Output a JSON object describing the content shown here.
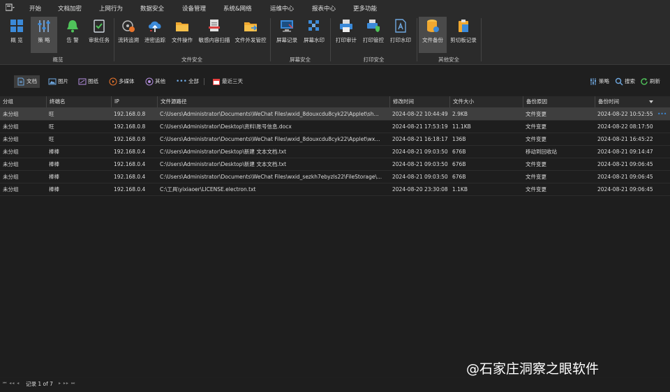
{
  "menubar": {
    "items": [
      "开始",
      "文档加密",
      "上网行为",
      "数据安全",
      "设备管理",
      "系统&网络",
      "运维中心",
      "报表中心",
      "更多功能"
    ],
    "active": "数据安全"
  },
  "ribbon": {
    "groups": [
      {
        "label": "概览",
        "buttons": [
          {
            "label": "概 览",
            "icon": "grid-icon"
          },
          {
            "label": "策 略",
            "icon": "sliders-icon",
            "active": true
          },
          {
            "label": "告 警",
            "icon": "bell-icon"
          },
          {
            "label": "审批任务",
            "icon": "checklist-icon"
          }
        ]
      },
      {
        "label": "文件安全",
        "buttons": [
          {
            "label": "流转追溯",
            "icon": "trace-icon"
          },
          {
            "label": "泄密追踪",
            "icon": "cloud-upload-icon"
          },
          {
            "label": "文件操作",
            "icon": "folder-icon"
          },
          {
            "label": "敏感内容扫描",
            "icon": "document-scan-icon"
          },
          {
            "label": "文件外发管控",
            "icon": "folder-send-icon"
          }
        ]
      },
      {
        "label": "屏幕安全",
        "buttons": [
          {
            "label": "屏幕记录",
            "icon": "monitor-icon"
          },
          {
            "label": "屏幕水印",
            "icon": "mosaic-icon"
          }
        ]
      },
      {
        "label": "打印安全",
        "buttons": [
          {
            "label": "打印审计",
            "icon": "printer-icon"
          },
          {
            "label": "打印管控",
            "icon": "printer-shield-icon"
          },
          {
            "label": "打印水印",
            "icon": "document-a-icon"
          }
        ]
      },
      {
        "label": "其他安全",
        "buttons": [
          {
            "label": "文件备份",
            "icon": "database-backup-icon",
            "active": true
          },
          {
            "label": "剪切板记录",
            "icon": "clipboard-icon"
          }
        ]
      }
    ]
  },
  "toolbar": {
    "filters": [
      {
        "label": "文档",
        "icon": "document-icon",
        "active": true
      },
      {
        "label": "图片",
        "icon": "image-icon"
      },
      {
        "label": "图纸",
        "icon": "drawing-icon"
      },
      {
        "label": "多媒体",
        "icon": "media-icon"
      },
      {
        "label": "其他",
        "icon": "other-icon"
      },
      {
        "label": "全部",
        "icon": "dots-icon"
      }
    ],
    "date_range": "最近三天",
    "strategy": "策略",
    "search": "搜索",
    "refresh": "刷新"
  },
  "table": {
    "columns": [
      "分组",
      "终端名",
      "IP",
      "文件源路径",
      "修改时间",
      "文件大小",
      "备份原因",
      "备份时间"
    ],
    "rows": [
      [
        "未分组",
        "旺",
        "192.168.0.8",
        "C:\\Users\\Administrator\\Documents\\WeChat Files\\wxid_8douxcdu8cyk22\\Applet\\sh...",
        "2024-08-22 10:44:49",
        "2.9KB",
        "文件变更",
        "2024-08-22 10:52:55"
      ],
      [
        "未分组",
        "旺",
        "192.168.0.8",
        "C:\\Users\\Administrator\\Desktop\\资料\\账号信息.docx",
        "2024-08-21 17:53:19",
        "11.1KB",
        "文件变更",
        "2024-08-22 08:17:50"
      ],
      [
        "未分组",
        "旺",
        "192.168.0.8",
        "C:\\Users\\Administrator\\Documents\\WeChat Files\\wxid_8douxcdu8cyk22\\Applet\\wx...",
        "2024-08-21 16:18:17",
        "136B",
        "文件变更",
        "2024-08-21 16:45:22"
      ],
      [
        "未分组",
        "棒棒",
        "192.168.0.4",
        "C:\\Users\\Administrator\\Desktop\\新建 文本文档.txt",
        "2024-08-21 09:03:50",
        "676B",
        "移动到回收站",
        "2024-08-21 09:14:47"
      ],
      [
        "未分组",
        "棒棒",
        "192.168.0.4",
        "C:\\Users\\Administrator\\Desktop\\新建 文本文档.txt",
        "2024-08-21 09:03:50",
        "676B",
        "文件变更",
        "2024-08-21 09:06:45"
      ],
      [
        "未分组",
        "棒棒",
        "192.168.0.4",
        "C:\\Users\\Administrator\\Documents\\WeChat Files\\wxid_sezkh7ebyzls22\\FileStorage\\...",
        "2024-08-21 09:03:50",
        "676B",
        "文件变更",
        "2024-08-21 09:06:45"
      ],
      [
        "未分组",
        "棒棒",
        "192.168.0.4",
        "C:\\工具\\yixiaoer\\LICENSE.electron.txt",
        "2024-08-20 23:30:08",
        "1.1KB",
        "文件变更",
        "2024-08-21 09:06:45"
      ]
    ],
    "selected_row": 0,
    "row_more": "•••"
  },
  "pager": {
    "text": "记录 1 of 7"
  },
  "watermark": {
    "text": "@石家庄洞察之眼软件"
  },
  "colors": {
    "accent": "#3b8ad9",
    "background": "#1f1f1f",
    "panel": "#2b2b2b"
  }
}
